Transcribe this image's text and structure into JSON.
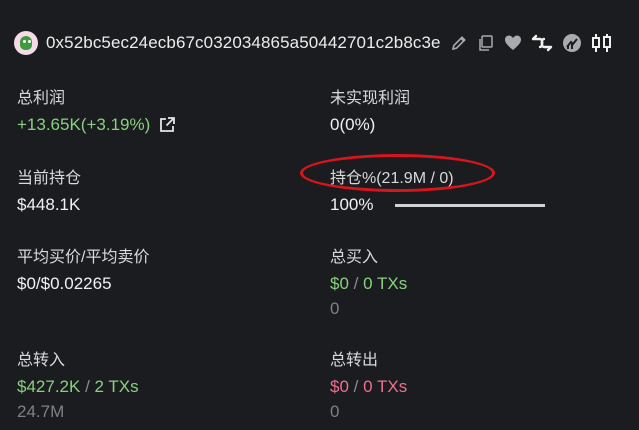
{
  "header": {
    "address": "0x52bc5ec24ecb67c032034865a50442701c2b8c3e",
    "icons": [
      "edit-icon",
      "copy-icon",
      "heart-icon",
      "swap-icon",
      "chart-icon",
      "candlestick-icon"
    ]
  },
  "stats": {
    "total_profit": {
      "label": "总利润",
      "value": "+13.65K(+3.19%)"
    },
    "unrealized_profit": {
      "label": "未实现利润",
      "value": "0(0%)"
    },
    "current_position": {
      "label": "当前持仓",
      "value": "$448.1K"
    },
    "holding_percent": {
      "label": "持仓%(21.9M / 0)",
      "value": "100%",
      "progress": 1.0
    },
    "avg_price": {
      "label": "平均买价/平均卖价",
      "value": "$0/$0.02265"
    },
    "total_buy": {
      "label": "总买入",
      "amount": "$0",
      "separator": "/",
      "txs": "0 TXs",
      "quantity": "0"
    },
    "total_transfer_in": {
      "label": "总转入",
      "amount": "$427.2K",
      "separator": "/",
      "txs": "2 TXs",
      "quantity": "24.7M"
    },
    "total_transfer_out": {
      "label": "总转出",
      "amount": "$0",
      "separator": "/",
      "txs": "0 TXs",
      "quantity": "0"
    }
  },
  "colors": {
    "positive": "#86d27c",
    "negative": "#ef6f8c",
    "highlight": "#d8151d"
  }
}
